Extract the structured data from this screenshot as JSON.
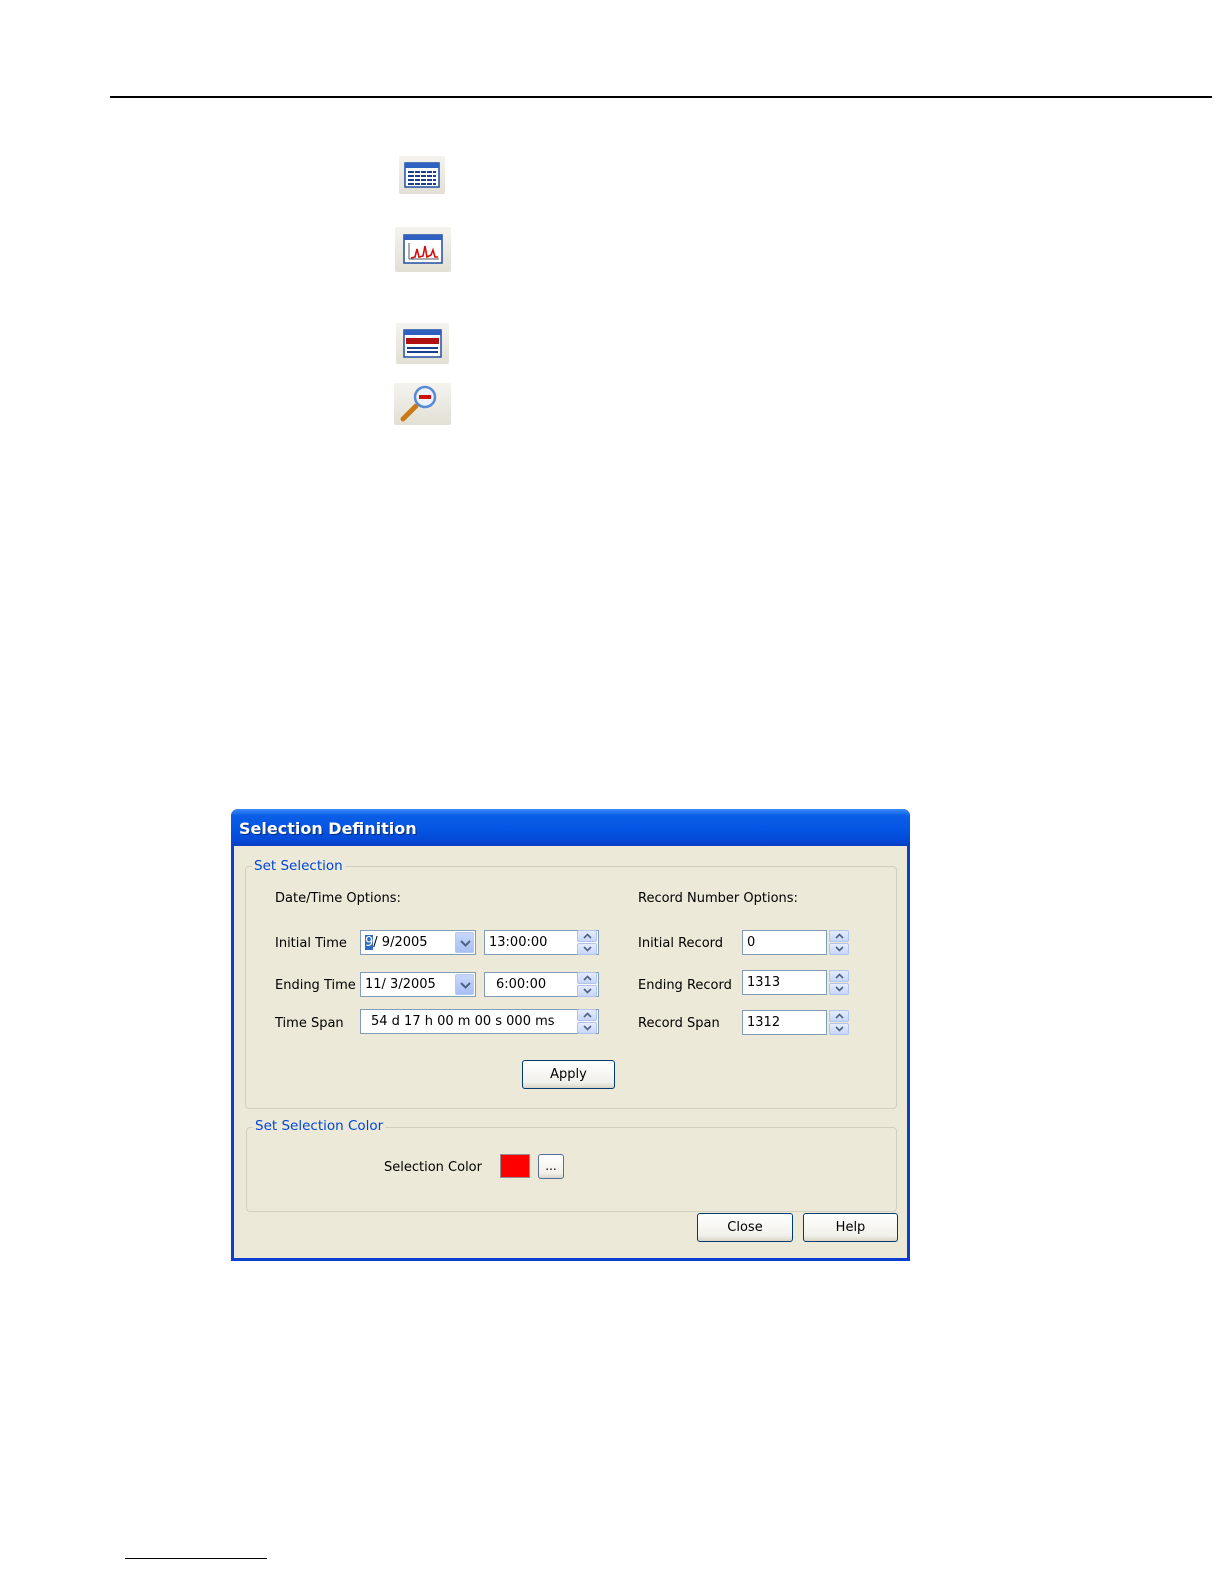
{
  "toolbar_icons": [
    {
      "name": "table-view-icon"
    },
    {
      "name": "graph-view-icon"
    },
    {
      "name": "selection-table-icon"
    },
    {
      "name": "zoom-out-icon"
    }
  ],
  "dialog": {
    "title": "Selection Definition",
    "set_selection": {
      "legend": "Set Selection",
      "datetime_heading": "Date/Time Options:",
      "record_heading": "Record Number Options:",
      "initial_time": {
        "label": "Initial Time",
        "date_sel": "9",
        "date_rest": "/  9/2005",
        "time": "13:00:00"
      },
      "ending_time": {
        "label": "Ending Time",
        "date": "11/  3/2005",
        "time": "6:00:00"
      },
      "time_span": {
        "label": "Time Span",
        "value": "54 d 17 h 00 m 00 s 000 ms"
      },
      "initial_record": {
        "label": "Initial Record",
        "value": "0"
      },
      "ending_record": {
        "label": "Ending Record",
        "value": "1313"
      },
      "record_span": {
        "label": "Record Span",
        "value": "1312"
      },
      "apply_label": "Apply"
    },
    "set_color": {
      "legend": "Set Selection Color",
      "label": "Selection Color",
      "color": "#ff0000",
      "browse_label": "..."
    },
    "close_label": "Close",
    "help_label": "Help"
  }
}
